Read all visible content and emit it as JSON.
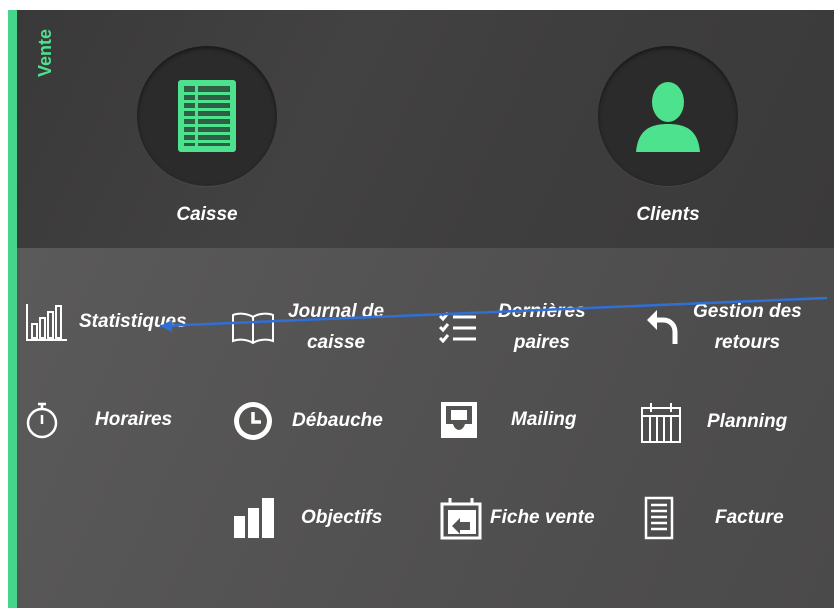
{
  "section": {
    "label": "Vente",
    "accent_color": "#46d68b"
  },
  "main_buttons": [
    {
      "label": "Caisse",
      "icon": "cash-register-sheet-icon"
    },
    {
      "label": "Clients",
      "icon": "person-icon"
    }
  ],
  "tiles": [
    {
      "label": "Statistiques",
      "icon": "bar-chart-icon"
    },
    {
      "label_line1": "Journal de",
      "label_line2": "caisse",
      "icon": "open-book-icon"
    },
    {
      "label_line1": "Dernières",
      "label_line2": "paires",
      "icon": "checklist-icon"
    },
    {
      "label_line1": "Gestion des",
      "label_line2": "retours",
      "icon": "undo-arrow-icon"
    },
    {
      "label": "Horaires",
      "icon": "stopwatch-icon"
    },
    {
      "label": "Débauche",
      "icon": "clock-icon"
    },
    {
      "label": "Mailing",
      "icon": "inbox-tray-icon"
    },
    {
      "label": "Planning",
      "icon": "calendar-icon"
    },
    {
      "label": "Objectifs",
      "icon": "ascending-bars-icon"
    },
    {
      "label": "Fiche vente",
      "icon": "form-transfer-icon"
    },
    {
      "label": "Facture",
      "icon": "invoice-document-icon"
    }
  ]
}
